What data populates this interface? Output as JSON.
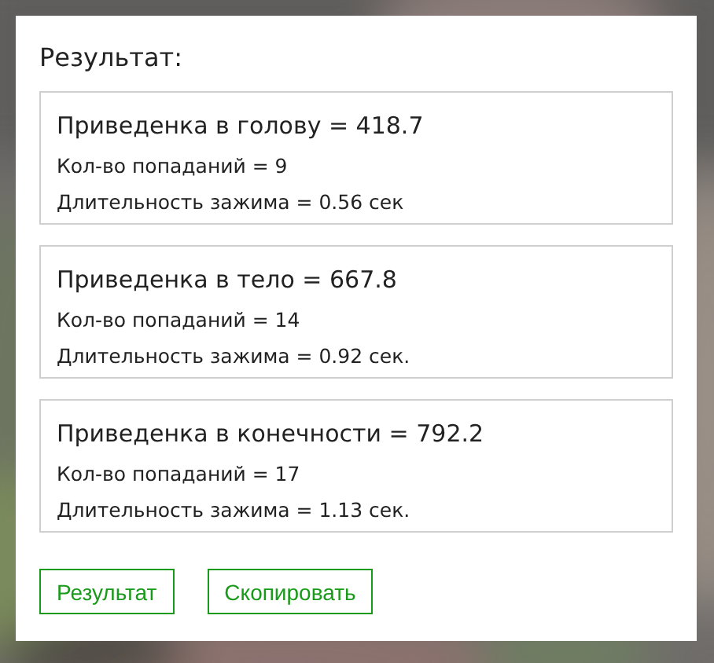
{
  "title": "Результат:",
  "results": [
    {
      "heading": "Приведенка в голову = 418.7",
      "hits": "Кол-во попаданий = 9",
      "duration": "Длительность зажима = 0.56 сек"
    },
    {
      "heading": "Приведенка в тело = 667.8",
      "hits": "Кол-во попаданий = 14",
      "duration": "Длительность зажима = 0.92 сек."
    },
    {
      "heading": "Приведенка в конечности = 792.2",
      "hits": "Кол-во попаданий = 17",
      "duration": "Длительность зажима = 1.13 сек."
    }
  ],
  "buttons": [
    "Результат",
    "Скопировать"
  ]
}
